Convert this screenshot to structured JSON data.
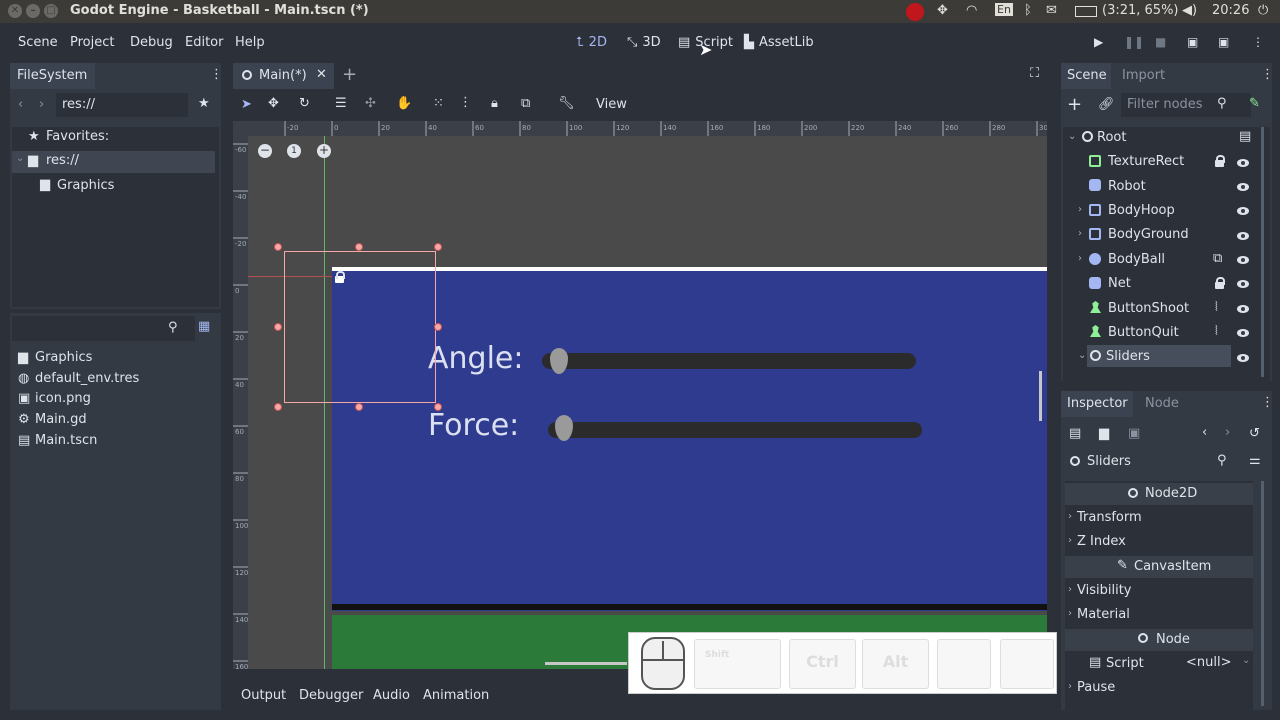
{
  "os": {
    "window_title": "Godot Engine - Basketball - Main.tscn (*)",
    "lang": "En",
    "battery": "(3:21, 65%)",
    "clock": "20:26"
  },
  "menus": [
    "Scene",
    "Project",
    "Debug",
    "Editor",
    "Help"
  ],
  "workspaces": [
    {
      "label": "2D",
      "icon": "2d-icon",
      "active": true
    },
    {
      "label": "3D",
      "icon": "3d-icon",
      "active": false
    },
    {
      "label": "Script",
      "icon": "script-icon",
      "active": false
    },
    {
      "label": "AssetLib",
      "icon": "assetlib-icon",
      "active": false
    }
  ],
  "filesystem": {
    "tab": "FileSystem",
    "path": "res://",
    "tree": {
      "favorites": "Favorites:",
      "root": "res://",
      "child": "Graphics"
    },
    "search_placeholder": "",
    "files": [
      {
        "name": "Graphics",
        "icon": "folder-icon"
      },
      {
        "name": "default_env.tres",
        "icon": "globe-icon"
      },
      {
        "name": "icon.png",
        "icon": "image-icon"
      },
      {
        "name": "Main.gd",
        "icon": "gear-icon"
      },
      {
        "name": "Main.tscn",
        "icon": "scene-icon"
      }
    ]
  },
  "editor": {
    "tab": "Main(*)",
    "view_menu": "View",
    "labels": {
      "angle": "Angle:",
      "force": "Force:"
    },
    "ruler_top": [
      "-20",
      "0",
      "20",
      "40",
      "60",
      "80",
      "100",
      "120",
      "140",
      "160",
      "180",
      "200",
      "220",
      "240",
      "260",
      "280",
      "300"
    ],
    "ruler_left": [
      "-60",
      "-40",
      "-20",
      "0",
      "20",
      "40",
      "60",
      "80",
      "100",
      "120",
      "140",
      "160"
    ]
  },
  "bottom_tabs": [
    "Output",
    "Debugger",
    "Audio",
    "Animation"
  ],
  "keys": [
    "Shift",
    "Ctrl",
    "Alt"
  ],
  "scene": {
    "tabs": [
      "Scene",
      "Import"
    ],
    "filter_placeholder": "Filter nodes",
    "nodes": [
      {
        "name": "Root",
        "indent": 0
      },
      {
        "name": "TextureRect",
        "indent": 1
      },
      {
        "name": "Robot",
        "indent": 1
      },
      {
        "name": "BodyHoop",
        "indent": 1
      },
      {
        "name": "BodyGround",
        "indent": 1
      },
      {
        "name": "BodyBall",
        "indent": 1
      },
      {
        "name": "Net",
        "indent": 1
      },
      {
        "name": "ButtonShoot",
        "indent": 1
      },
      {
        "name": "ButtonQuit",
        "indent": 1
      },
      {
        "name": "Sliders",
        "indent": 1
      }
    ]
  },
  "inspector": {
    "tabs": [
      "Inspector",
      "Node"
    ],
    "selected": "Sliders",
    "sections": [
      {
        "label": "Node2D",
        "type": "header"
      },
      {
        "label": "Transform",
        "type": "group"
      },
      {
        "label": "Z Index",
        "type": "group"
      },
      {
        "label": "CanvasItem",
        "type": "header"
      },
      {
        "label": "Visibility",
        "type": "group"
      },
      {
        "label": "Material",
        "type": "group"
      },
      {
        "label": "Node",
        "type": "header"
      }
    ],
    "script_label": "Script",
    "script_value": "<null>",
    "pause_label": "Pause"
  },
  "colors": {
    "accent": "#a5b7f3",
    "field": "#2e3b8f",
    "ground": "#2c7a3a",
    "selection": "#f5a8a8"
  }
}
